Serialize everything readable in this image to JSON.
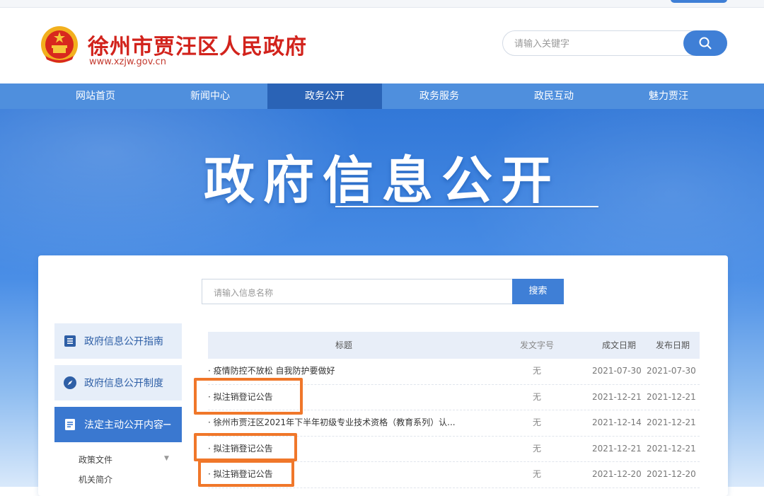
{
  "header": {
    "site_name": "徐州市贾汪区人民政府",
    "site_url": "www.xzjw.gov.cn",
    "search_placeholder": "请输入关键字"
  },
  "nav": {
    "items": [
      "网站首页",
      "新闻中心",
      "政务公开",
      "政务服务",
      "政民互动",
      "魅力贾汪"
    ],
    "active": "政务公开"
  },
  "hero": {
    "title": "政府信息公开"
  },
  "info_search": {
    "placeholder": "请输入信息名称",
    "button": "搜索"
  },
  "sidebar": {
    "items": [
      {
        "label": "政府信息公开指南",
        "icon": "list-icon"
      },
      {
        "label": "政府信息公开制度",
        "icon": "compass-icon"
      },
      {
        "label": "法定主动公开内容",
        "icon": "document-icon",
        "expanded": "−"
      }
    ],
    "subitems": [
      "政策文件",
      "机关简介"
    ]
  },
  "table": {
    "headers": {
      "title": "标题",
      "doc_no": "发文字号",
      "created": "成文日期",
      "published": "发布日期"
    },
    "rows": [
      {
        "title": "· 疫情防控不放松 自我防护要做好",
        "doc_no": "无",
        "created": "2021-07-30",
        "published": "2021-07-30",
        "highlighted": false
      },
      {
        "title": "· 拟注销登记公告",
        "doc_no": "无",
        "created": "2021-12-21",
        "published": "2021-12-21",
        "highlighted": true
      },
      {
        "title": "· 徐州市贾汪区2021年下半年初级专业技术资格（教育系列）认...",
        "doc_no": "无",
        "created": "2021-12-14",
        "published": "2021-12-21",
        "highlighted": false
      },
      {
        "title": "· 拟注销登记公告",
        "doc_no": "无",
        "created": "2021-12-21",
        "published": "2021-12-21",
        "highlighted": true
      },
      {
        "title": "· 拟注销登记公告",
        "doc_no": "无",
        "created": "2021-12-20",
        "published": "2021-12-20",
        "highlighted": true
      }
    ]
  },
  "colors": {
    "brand_red": "#d2231c",
    "nav_blue": "#4f8fdd",
    "nav_active": "#2a63b6",
    "accent_blue": "#3f7fd6",
    "highlight_orange": "#f0772a"
  }
}
